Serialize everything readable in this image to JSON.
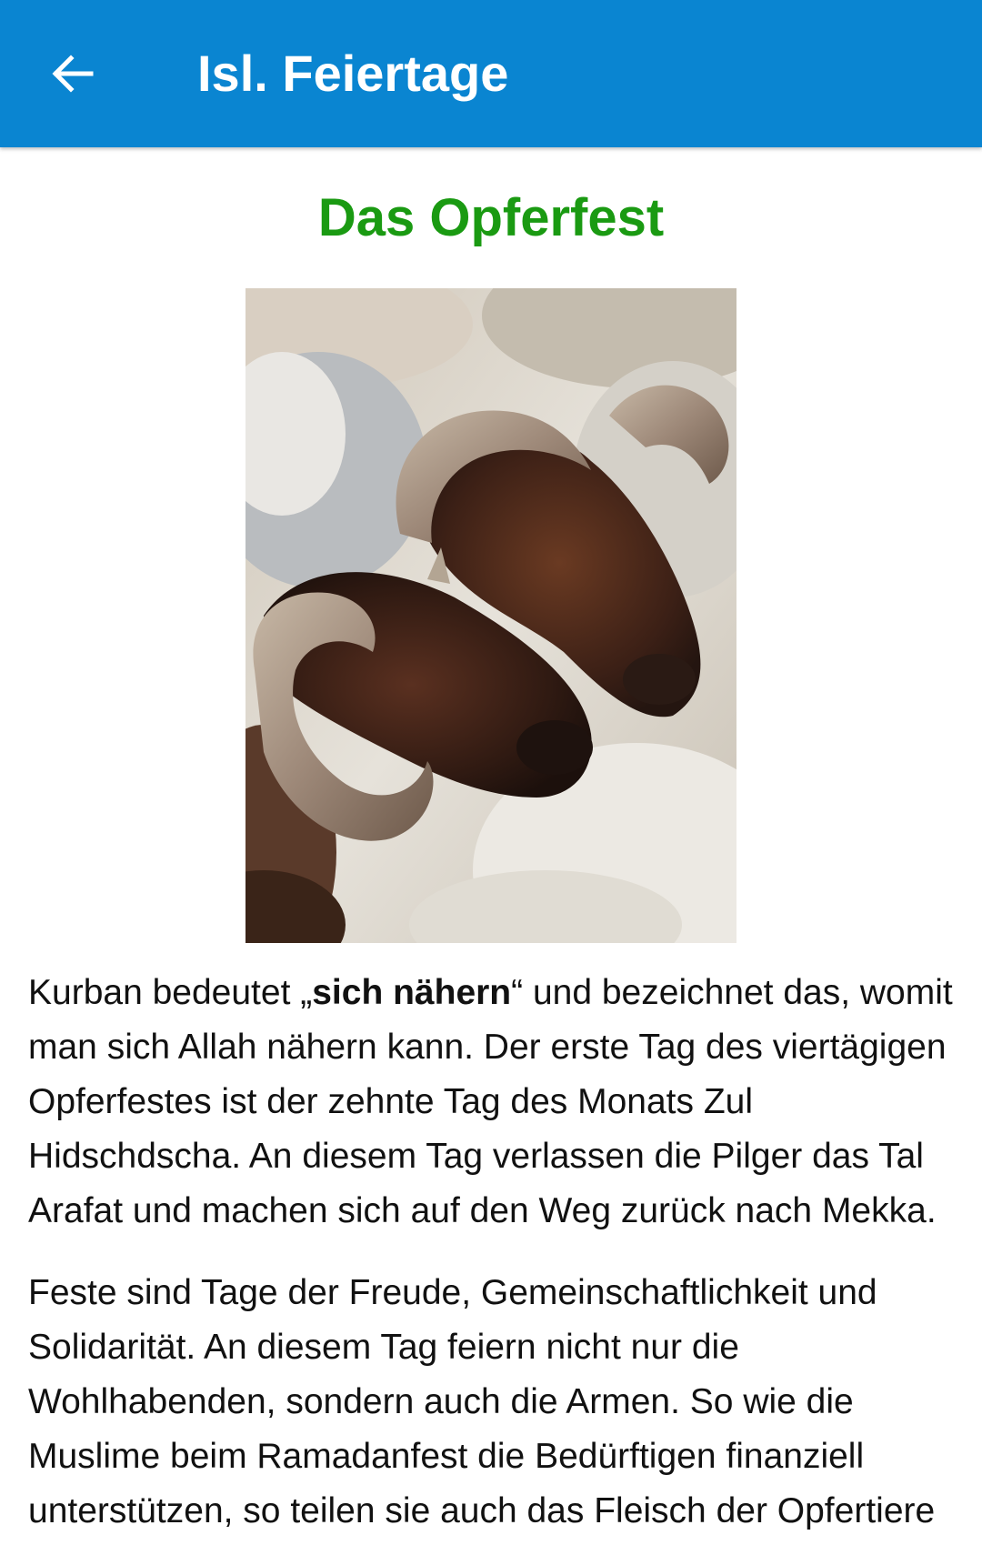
{
  "appbar": {
    "title": "Isl. Feiertage",
    "back_icon": "arrow-left-icon",
    "background_color": "#0a85d1"
  },
  "article": {
    "heading": "Das Opferfest",
    "heading_color": "#1a9a12",
    "image": "rams-photo",
    "paragraph1": {
      "before": "Kurban bedeutet „",
      "bold": "sich nähern",
      "after": "“ und bezeichnet das, womit man sich Allah nähern kann. Der erste Tag des viertägigen Opferfestes ist der zehnte Tag des Monats Zul Hidschdscha. An diesem Tag verlassen die Pilger das Tal Arafat und machen sich auf den Weg zurück nach Mekka."
    },
    "paragraph2": "Feste sind Tage der Freude, Gemeinschaftlichkeit und Solidarität. An diesem Tag feiern nicht nur die Wohlhabenden, sondern auch die Armen. So wie die Muslime beim Ramadanfest die Bedürftigen finanziell unterstützen, so teilen sie auch das Fleisch der Opfertiere"
  }
}
